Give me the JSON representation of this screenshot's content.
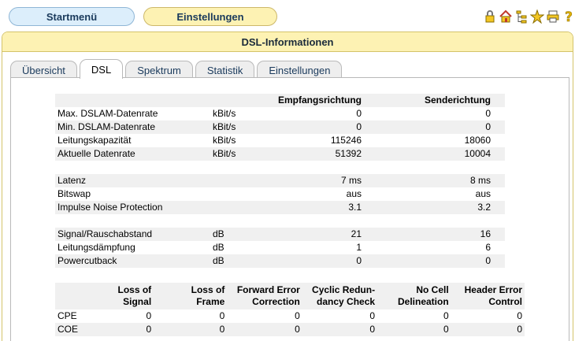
{
  "top_nav": {
    "start_label": "Startmenü",
    "settings_label": "Einstellungen"
  },
  "toolbar_icons": [
    "lock-icon",
    "home-icon",
    "tree-icon",
    "star-icon",
    "print-icon",
    "help-icon"
  ],
  "panel": {
    "title": "DSL-Informationen"
  },
  "tabs": [
    "Übersicht",
    "DSL",
    "Spektrum",
    "Statistik",
    "Einstellungen"
  ],
  "active_tab": "DSL",
  "dsl_table": {
    "headers": {
      "downstream": "Empfangsrichtung",
      "upstream": "Senderichtung"
    },
    "rows": [
      {
        "label": "Max. DSLAM-Datenrate",
        "unit": "kBit/s",
        "down": "0",
        "up": "0"
      },
      {
        "label": "Min. DSLAM-Datenrate",
        "unit": "kBit/s",
        "down": "0",
        "up": "0"
      },
      {
        "label": "Leitungskapazität",
        "unit": "kBit/s",
        "down": "115246",
        "up": "18060"
      },
      {
        "label": "Aktuelle Datenrate",
        "unit": "kBit/s",
        "down": "51392",
        "up": "10004"
      },
      {
        "label": "",
        "unit": "",
        "down": "",
        "up": ""
      },
      {
        "label": "Latenz",
        "unit": "",
        "down": "7 ms",
        "up": "8 ms"
      },
      {
        "label": "Bitswap",
        "unit": "",
        "down": "aus",
        "up": "aus"
      },
      {
        "label": "Impulse Noise Protection",
        "unit": "",
        "down": "3.1",
        "up": "3.2"
      },
      {
        "label": "",
        "unit": "",
        "down": "",
        "up": ""
      },
      {
        "label": "Signal/Rauschabstand",
        "unit": "dB",
        "down": "21",
        "up": "16"
      },
      {
        "label": "Leitungsdämpfung",
        "unit": "dB",
        "down": "1",
        "up": "6"
      },
      {
        "label": "Powercutback",
        "unit": "dB",
        "down": "0",
        "up": "0"
      }
    ]
  },
  "error_table": {
    "headers": [
      "Loss of\nSignal",
      "Loss of\nFrame",
      "Forward Error\nCorrection",
      "Cyclic Redun-\ndancy Check",
      "No Cell\nDelineation",
      "Header Error\nControl"
    ],
    "rows": [
      {
        "label": "CPE",
        "values": [
          "0",
          "0",
          "0",
          "0",
          "0",
          "0"
        ]
      },
      {
        "label": "COE",
        "values": [
          "0",
          "0",
          "0",
          "0",
          "0",
          "0"
        ]
      }
    ]
  }
}
